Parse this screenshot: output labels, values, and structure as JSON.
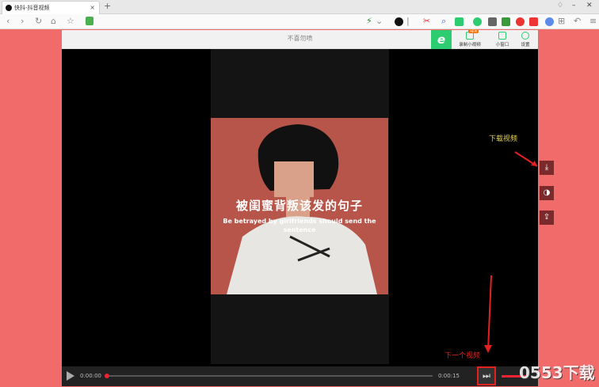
{
  "browser": {
    "tab_title": "快抖-抖音视频",
    "tab_close": "×",
    "new_tab": "+"
  },
  "page": {
    "title": "不喜勿喷"
  },
  "header_buttons": [
    {
      "label": "录制小视频",
      "badge": "NEW"
    },
    {
      "label": "小窗口"
    },
    {
      "label": "设置"
    }
  ],
  "video": {
    "subtitle_cn": "被闺蜜背叛该发的句子",
    "subtitle_en": "Be betrayed by girlfriends should send the sentence",
    "frame_color": "#b7554a"
  },
  "side_actions": [
    {
      "icon": "download-icon"
    },
    {
      "icon": "contrast-icon"
    },
    {
      "icon": "share-icon"
    }
  ],
  "annotations": {
    "download": "下载视频",
    "next": "下一个视频"
  },
  "player": {
    "current_time": "0:00:00",
    "duration": "0:00:15",
    "progress": 0.0
  },
  "watermark": "0553下载",
  "colors": {
    "background": "#f26b6b",
    "accent": "#2ecc71",
    "annotation_red": "#e52020",
    "annotation_yellow": "#e8d44d"
  }
}
